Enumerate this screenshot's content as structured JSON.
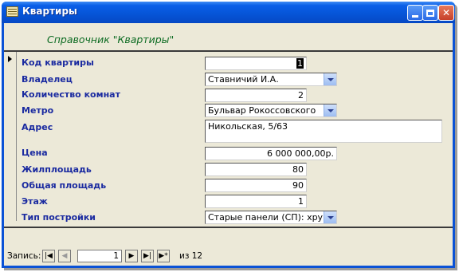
{
  "window": {
    "title": "Квартиры"
  },
  "form": {
    "header": "Справочник \"Квартиры\"",
    "fields": {
      "apartment_id": {
        "label": "Код квартиры",
        "value": "1"
      },
      "owner": {
        "label": "Владелец",
        "value": "Ставничий И.А."
      },
      "rooms": {
        "label": "Количество комнат",
        "value": "2"
      },
      "metro": {
        "label": "Метро",
        "value": "Бульвар Рокоссовского"
      },
      "address": {
        "label": "Адрес",
        "value": "Никольская, 5/63"
      },
      "price": {
        "label": "Цена",
        "value": "6 000 000,00р."
      },
      "living_area": {
        "label": "Жилплощадь",
        "value": "80"
      },
      "total_area": {
        "label": "Общая площадь",
        "value": "90"
      },
      "floor": {
        "label": "Этаж",
        "value": "1"
      },
      "building_type": {
        "label": "Тип постройки",
        "value": "Старые панели (СП): хрущевк"
      }
    }
  },
  "navigation": {
    "label": "Запись:",
    "current": "1",
    "of_text": "из 12",
    "first_icon": "first-record-icon",
    "prev_icon": "prev-record-icon",
    "next_icon": "next-record-icon",
    "last_icon": "last-record-icon",
    "new_icon": "new-record-icon"
  }
}
